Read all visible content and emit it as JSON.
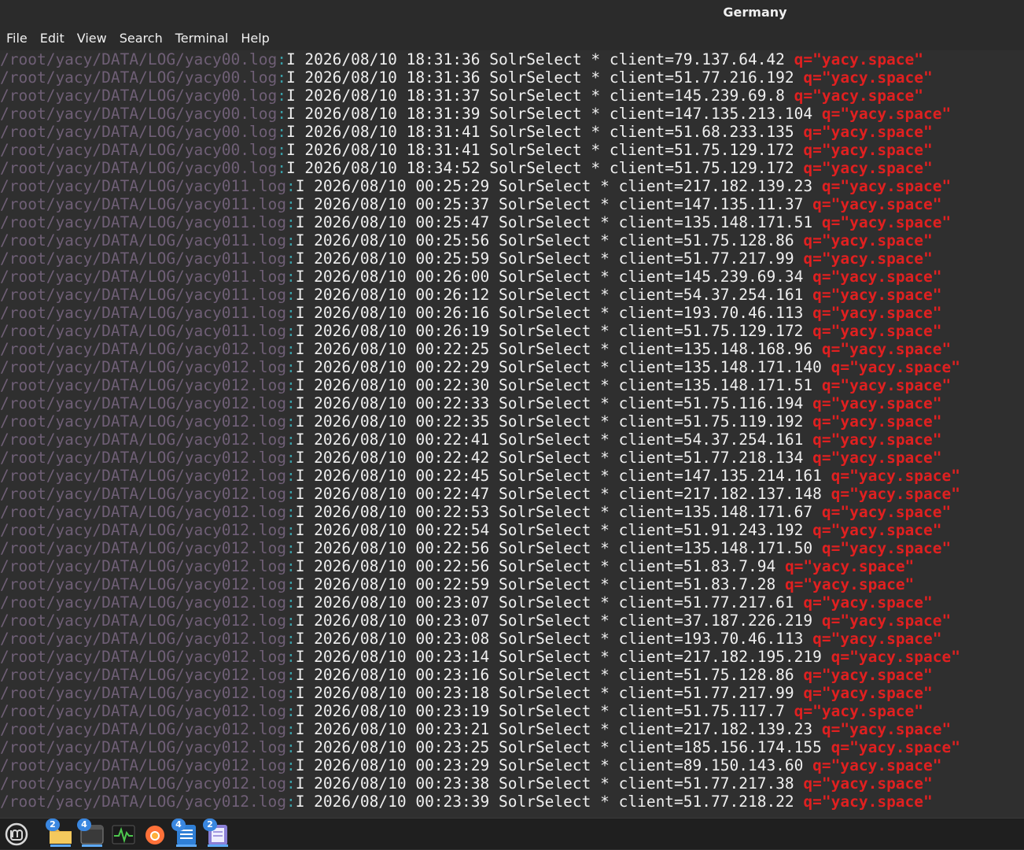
{
  "window": {
    "title": "Germany"
  },
  "menu": [
    "File",
    "Edit",
    "View",
    "Search",
    "Terminal",
    "Help"
  ],
  "terminal": {
    "lines": [
      {
        "path": "/root/yacy/DATA/LOG/yacy00.log",
        "colon": ":",
        "text": "I 2026/08/10 18:31:36 SolrSelect * client=79.137.64.42 ",
        "query": "q=\"yacy.space\""
      },
      {
        "path": "/root/yacy/DATA/LOG/yacy00.log",
        "colon": ":",
        "text": "I 2026/08/10 18:31:36 SolrSelect * client=51.77.216.192 ",
        "query": "q=\"yacy.space\""
      },
      {
        "path": "/root/yacy/DATA/LOG/yacy00.log",
        "colon": ":",
        "text": "I 2026/08/10 18:31:37 SolrSelect * client=145.239.69.8 ",
        "query": "q=\"yacy.space\""
      },
      {
        "path": "/root/yacy/DATA/LOG/yacy00.log",
        "colon": ":",
        "text": "I 2026/08/10 18:31:39 SolrSelect * client=147.135.213.104 ",
        "query": "q=\"yacy.space\""
      },
      {
        "path": "/root/yacy/DATA/LOG/yacy00.log",
        "colon": ":",
        "text": "I 2026/08/10 18:31:41 SolrSelect * client=51.68.233.135 ",
        "query": "q=\"yacy.space\""
      },
      {
        "path": "/root/yacy/DATA/LOG/yacy00.log",
        "colon": ":",
        "text": "I 2026/08/10 18:31:41 SolrSelect * client=51.75.129.172 ",
        "query": "q=\"yacy.space\""
      },
      {
        "path": "/root/yacy/DATA/LOG/yacy00.log",
        "colon": ":",
        "text": "I 2026/08/10 18:34:52 SolrSelect * client=51.75.129.172 ",
        "query": "q=\"yacy.space\""
      },
      {
        "path": "/root/yacy/DATA/LOG/yacy011.log",
        "colon": ":",
        "text": "I 2026/08/10 00:25:29 SolrSelect * client=217.182.139.23 ",
        "query": "q=\"yacy.space\""
      },
      {
        "path": "/root/yacy/DATA/LOG/yacy011.log",
        "colon": ":",
        "text": "I 2026/08/10 00:25:37 SolrSelect * client=147.135.11.37 ",
        "query": "q=\"yacy.space\""
      },
      {
        "path": "/root/yacy/DATA/LOG/yacy011.log",
        "colon": ":",
        "text": "I 2026/08/10 00:25:47 SolrSelect * client=135.148.171.51 ",
        "query": "q=\"yacy.space\""
      },
      {
        "path": "/root/yacy/DATA/LOG/yacy011.log",
        "colon": ":",
        "text": "I 2026/08/10 00:25:56 SolrSelect * client=51.75.128.86 ",
        "query": "q=\"yacy.space\""
      },
      {
        "path": "/root/yacy/DATA/LOG/yacy011.log",
        "colon": ":",
        "text": "I 2026/08/10 00:25:59 SolrSelect * client=51.77.217.99 ",
        "query": "q=\"yacy.space\""
      },
      {
        "path": "/root/yacy/DATA/LOG/yacy011.log",
        "colon": ":",
        "text": "I 2026/08/10 00:26:00 SolrSelect * client=145.239.69.34 ",
        "query": "q=\"yacy.space\""
      },
      {
        "path": "/root/yacy/DATA/LOG/yacy011.log",
        "colon": ":",
        "text": "I 2026/08/10 00:26:12 SolrSelect * client=54.37.254.161 ",
        "query": "q=\"yacy.space\""
      },
      {
        "path": "/root/yacy/DATA/LOG/yacy011.log",
        "colon": ":",
        "text": "I 2026/08/10 00:26:16 SolrSelect * client=193.70.46.113 ",
        "query": "q=\"yacy.space\""
      },
      {
        "path": "/root/yacy/DATA/LOG/yacy011.log",
        "colon": ":",
        "text": "I 2026/08/10 00:26:19 SolrSelect * client=51.75.129.172 ",
        "query": "q=\"yacy.space\""
      },
      {
        "path": "/root/yacy/DATA/LOG/yacy012.log",
        "colon": ":",
        "text": "I 2026/08/10 00:22:25 SolrSelect * client=135.148.168.96 ",
        "query": "q=\"yacy.space\""
      },
      {
        "path": "/root/yacy/DATA/LOG/yacy012.log",
        "colon": ":",
        "text": "I 2026/08/10 00:22:29 SolrSelect * client=135.148.171.140 ",
        "query": "q=\"yacy.space\""
      },
      {
        "path": "/root/yacy/DATA/LOG/yacy012.log",
        "colon": ":",
        "text": "I 2026/08/10 00:22:30 SolrSelect * client=135.148.171.51 ",
        "query": "q=\"yacy.space\""
      },
      {
        "path": "/root/yacy/DATA/LOG/yacy012.log",
        "colon": ":",
        "text": "I 2026/08/10 00:22:33 SolrSelect * client=51.75.116.194 ",
        "query": "q=\"yacy.space\""
      },
      {
        "path": "/root/yacy/DATA/LOG/yacy012.log",
        "colon": ":",
        "text": "I 2026/08/10 00:22:35 SolrSelect * client=51.75.119.192 ",
        "query": "q=\"yacy.space\""
      },
      {
        "path": "/root/yacy/DATA/LOG/yacy012.log",
        "colon": ":",
        "text": "I 2026/08/10 00:22:41 SolrSelect * client=54.37.254.161 ",
        "query": "q=\"yacy.space\""
      },
      {
        "path": "/root/yacy/DATA/LOG/yacy012.log",
        "colon": ":",
        "text": "I 2026/08/10 00:22:42 SolrSelect * client=51.77.218.134 ",
        "query": "q=\"yacy.space\""
      },
      {
        "path": "/root/yacy/DATA/LOG/yacy012.log",
        "colon": ":",
        "text": "I 2026/08/10 00:22:45 SolrSelect * client=147.135.214.161 ",
        "query": "q=\"yacy.space\""
      },
      {
        "path": "/root/yacy/DATA/LOG/yacy012.log",
        "colon": ":",
        "text": "I 2026/08/10 00:22:47 SolrSelect * client=217.182.137.148 ",
        "query": "q=\"yacy.space\""
      },
      {
        "path": "/root/yacy/DATA/LOG/yacy012.log",
        "colon": ":",
        "text": "I 2026/08/10 00:22:53 SolrSelect * client=135.148.171.67 ",
        "query": "q=\"yacy.space\""
      },
      {
        "path": "/root/yacy/DATA/LOG/yacy012.log",
        "colon": ":",
        "text": "I 2026/08/10 00:22:54 SolrSelect * client=51.91.243.192 ",
        "query": "q=\"yacy.space\""
      },
      {
        "path": "/root/yacy/DATA/LOG/yacy012.log",
        "colon": ":",
        "text": "I 2026/08/10 00:22:56 SolrSelect * client=135.148.171.50 ",
        "query": "q=\"yacy.space\""
      },
      {
        "path": "/root/yacy/DATA/LOG/yacy012.log",
        "colon": ":",
        "text": "I 2026/08/10 00:22:56 SolrSelect * client=51.83.7.94 ",
        "query": "q=\"yacy.space\""
      },
      {
        "path": "/root/yacy/DATA/LOG/yacy012.log",
        "colon": ":",
        "text": "I 2026/08/10 00:22:59 SolrSelect * client=51.83.7.28 ",
        "query": "q=\"yacy.space\""
      },
      {
        "path": "/root/yacy/DATA/LOG/yacy012.log",
        "colon": ":",
        "text": "I 2026/08/10 00:23:07 SolrSelect * client=51.77.217.61 ",
        "query": "q=\"yacy.space\""
      },
      {
        "path": "/root/yacy/DATA/LOG/yacy012.log",
        "colon": ":",
        "text": "I 2026/08/10 00:23:07 SolrSelect * client=37.187.226.219 ",
        "query": "q=\"yacy.space\""
      },
      {
        "path": "/root/yacy/DATA/LOG/yacy012.log",
        "colon": ":",
        "text": "I 2026/08/10 00:23:08 SolrSelect * client=193.70.46.113 ",
        "query": "q=\"yacy.space\""
      },
      {
        "path": "/root/yacy/DATA/LOG/yacy012.log",
        "colon": ":",
        "text": "I 2026/08/10 00:23:14 SolrSelect * client=217.182.195.219 ",
        "query": "q=\"yacy.space\""
      },
      {
        "path": "/root/yacy/DATA/LOG/yacy012.log",
        "colon": ":",
        "text": "I 2026/08/10 00:23:16 SolrSelect * client=51.75.128.86 ",
        "query": "q=\"yacy.space\""
      },
      {
        "path": "/root/yacy/DATA/LOG/yacy012.log",
        "colon": ":",
        "text": "I 2026/08/10 00:23:18 SolrSelect * client=51.77.217.99 ",
        "query": "q=\"yacy.space\""
      },
      {
        "path": "/root/yacy/DATA/LOG/yacy012.log",
        "colon": ":",
        "text": "I 2026/08/10 00:23:19 SolrSelect * client=51.75.117.7 ",
        "query": "q=\"yacy.space\""
      },
      {
        "path": "/root/yacy/DATA/LOG/yacy012.log",
        "colon": ":",
        "text": "I 2026/08/10 00:23:21 SolrSelect * client=217.182.139.23 ",
        "query": "q=\"yacy.space\""
      },
      {
        "path": "/root/yacy/DATA/LOG/yacy012.log",
        "colon": ":",
        "text": "I 2026/08/10 00:23:25 SolrSelect * client=185.156.174.155 ",
        "query": "q=\"yacy.space\""
      },
      {
        "path": "/root/yacy/DATA/LOG/yacy012.log",
        "colon": ":",
        "text": "I 2026/08/10 00:23:29 SolrSelect * client=89.150.143.60 ",
        "query": "q=\"yacy.space\""
      },
      {
        "path": "/root/yacy/DATA/LOG/yacy012.log",
        "colon": ":",
        "text": "I 2026/08/10 00:23:38 SolrSelect * client=51.77.217.38 ",
        "query": "q=\"yacy.space\""
      },
      {
        "path": "/root/yacy/DATA/LOG/yacy012.log",
        "colon": ":",
        "text": "I 2026/08/10 00:23:39 SolrSelect * client=51.77.218.22 ",
        "query": "q=\"yacy.space\""
      }
    ]
  },
  "taskbar": {
    "items": [
      {
        "icon": "mint-menu-icon",
        "badge": ""
      },
      {
        "icon": "folder-icon",
        "badge": "2"
      },
      {
        "icon": "terminal-icon",
        "badge": "4"
      },
      {
        "icon": "system-monitor-icon",
        "badge": ""
      },
      {
        "icon": "firefox-icon",
        "badge": ""
      },
      {
        "icon": "text-editor-icon",
        "badge": "4"
      },
      {
        "icon": "notes-icon",
        "badge": "2"
      }
    ]
  },
  "colors": {
    "path": "#6f5f76",
    "separator": "#3aa0a8",
    "text": "#efefef",
    "query": "#e02020",
    "background": "#2f2f2f"
  }
}
